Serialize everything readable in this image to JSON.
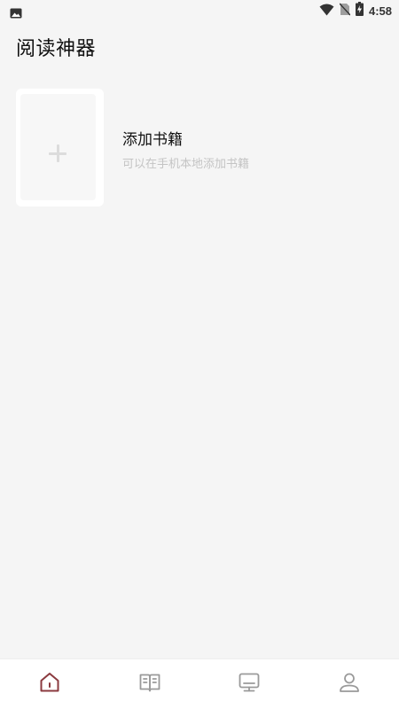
{
  "status_bar": {
    "time": "4:58",
    "icons": [
      "image-icon",
      "wifi-icon",
      "no-sim-icon",
      "battery-charging-icon"
    ]
  },
  "header": {
    "title": "阅读神器"
  },
  "add_book": {
    "title": "添加书籍",
    "subtitle": "可以在手机本地添加书籍",
    "icon": "plus-icon"
  },
  "bottom_nav": {
    "items": [
      {
        "icon": "home-icon",
        "active": true
      },
      {
        "icon": "book-icon",
        "active": false
      },
      {
        "icon": "monitor-icon",
        "active": false
      },
      {
        "icon": "user-icon",
        "active": false
      }
    ],
    "active_color": "#8b3a3f",
    "inactive_color": "#9a9a9a"
  }
}
